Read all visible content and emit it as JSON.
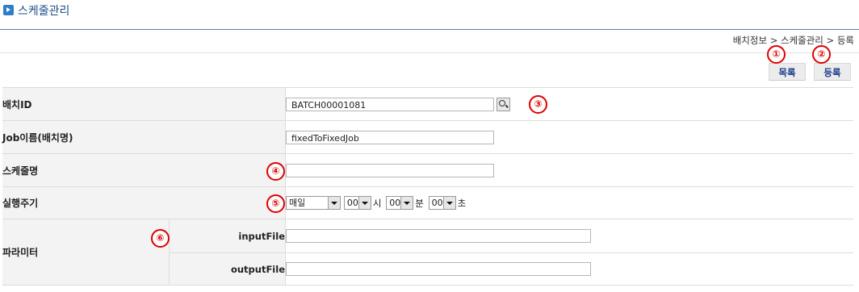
{
  "page": {
    "title": "스케줄관리"
  },
  "breadcrumb": {
    "text": "배치정보 > 스케줄관리 > 등록"
  },
  "buttons": {
    "list": "목록",
    "register": "등록"
  },
  "markers": [
    "①",
    "②",
    "③",
    "④",
    "⑤",
    "⑥"
  ],
  "form": {
    "batch_id": {
      "label": "배치ID",
      "value": "BATCH00001081"
    },
    "job_name": {
      "label": "Job이름(배치명)",
      "value": "fixedToFixedJob"
    },
    "schedule_name": {
      "label": "스케줄명",
      "value": ""
    },
    "cycle": {
      "label": "실행주기",
      "period": "매일",
      "hour": "00",
      "hour_unit": "시",
      "minute": "00",
      "minute_unit": "분",
      "second": "00",
      "second_unit": "초"
    },
    "params": {
      "label": "파라미터",
      "input_label": "inputFile",
      "input_value": "",
      "output_label": "outputFile",
      "output_value": ""
    }
  }
}
